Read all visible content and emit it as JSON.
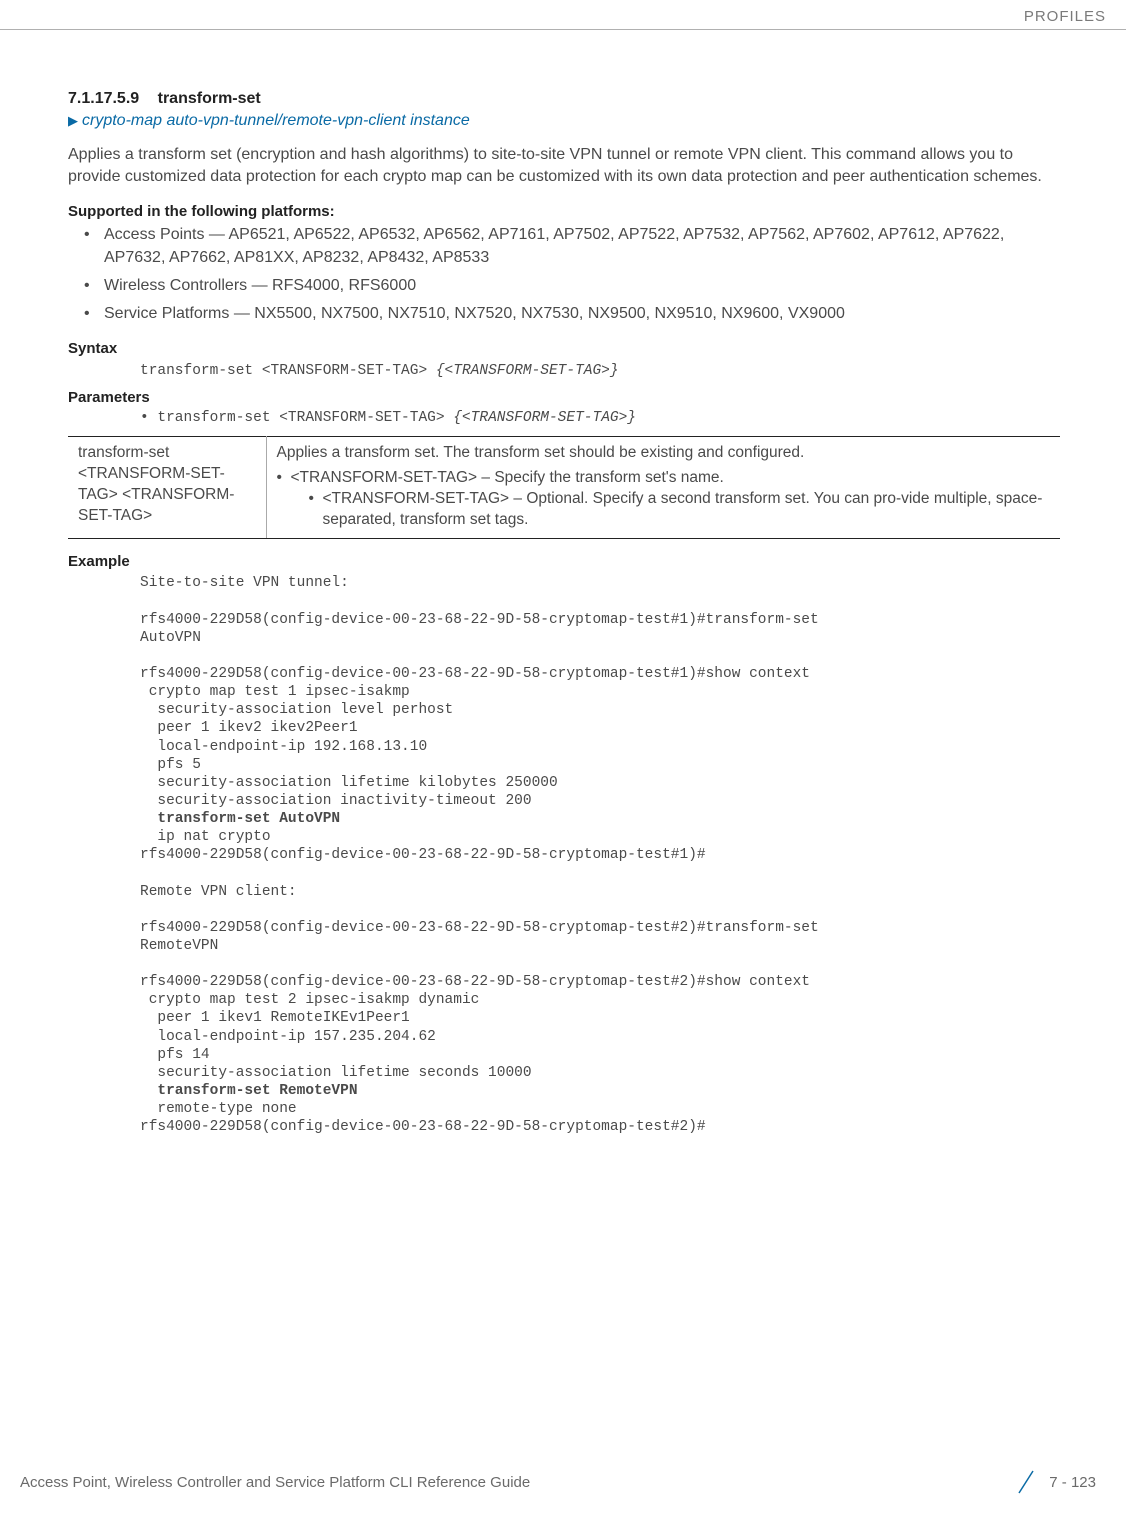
{
  "header": {
    "category": "PROFILES"
  },
  "section": {
    "number": "7.1.17.5.9",
    "title": "transform-set",
    "breadcrumb": "crypto-map auto-vpn-tunnel/remote-vpn-client instance"
  },
  "intro": "Applies a transform set (encryption and hash algorithms) to site-to-site VPN tunnel or remote VPN client. This command allows you to provide customized data protection for each crypto map can be customized with its own data protection and peer authentication schemes.",
  "platforms": {
    "heading": "Supported in the following platforms:",
    "items": [
      "Access Points — AP6521, AP6522, AP6532, AP6562, AP7161, AP7502, AP7522, AP7532, AP7562, AP7602, AP7612, AP7622, AP7632, AP7662, AP81XX, AP8232, AP8432, AP8533",
      "Wireless Controllers — RFS4000, RFS6000",
      "Service Platforms — NX5500, NX7500, NX7510, NX7520, NX7530, NX9500, NX9510, NX9600, VX9000"
    ]
  },
  "syntax": {
    "heading": "Syntax",
    "line_plain": "transform-set <TRANSFORM-SET-TAG> ",
    "line_ital": "{<TRANSFORM-SET-TAG>}"
  },
  "parameters": {
    "heading": "Parameters",
    "bullet_plain": "transform-set <TRANSFORM-SET-TAG> ",
    "bullet_ital": "{<TRANSFORM-SET-TAG>}",
    "table": {
      "left": "transform-set <TRANSFORM-SET-TAG> <TRANSFORM-SET-TAG>",
      "right_top": "Applies a transform set. The transform set should be existing and configured.",
      "right_b1": "<TRANSFORM-SET-TAG> – Specify the transform set's name.",
      "right_b2": "<TRANSFORM-SET-TAG> – Optional. Specify a second transform set. You can pro-vide multiple, space-separated, transform set tags."
    }
  },
  "example": {
    "heading": "Example",
    "l1": "Site-to-site VPN tunnel:",
    "l2": "rfs4000-229D58(config-device-00-23-68-22-9D-58-cryptomap-test#1)#transform-set",
    "l3": "AutoVPN",
    "l4": "rfs4000-229D58(config-device-00-23-68-22-9D-58-cryptomap-test#1)#show context",
    "l5": " crypto map test 1 ipsec-isakmp",
    "l6": "  security-association level perhost",
    "l7": "  peer 1 ikev2 ikev2Peer1",
    "l8": "  local-endpoint-ip 192.168.13.10",
    "l9": "  pfs 5",
    "l10": "  security-association lifetime kilobytes 250000",
    "l11": "  security-association inactivity-timeout 200",
    "l12": "  transform-set AutoVPN",
    "l13": "  ip nat crypto",
    "l14": "rfs4000-229D58(config-device-00-23-68-22-9D-58-cryptomap-test#1)#",
    "l15": "Remote VPN client:",
    "l16": "rfs4000-229D58(config-device-00-23-68-22-9D-58-cryptomap-test#2)#transform-set",
    "l17": "RemoteVPN",
    "l18": "rfs4000-229D58(config-device-00-23-68-22-9D-58-cryptomap-test#2)#show context",
    "l19": " crypto map test 2 ipsec-isakmp dynamic",
    "l20": "  peer 1 ikev1 RemoteIKEv1Peer1",
    "l21": "  local-endpoint-ip 157.235.204.62",
    "l22": "  pfs 14",
    "l23": "  security-association lifetime seconds 10000",
    "l24": "  transform-set RemoteVPN",
    "l25": "  remote-type none",
    "l26": "rfs4000-229D58(config-device-00-23-68-22-9D-58-cryptomap-test#2)#"
  },
  "footer": {
    "guide": "Access Point, Wireless Controller and Service Platform CLI Reference Guide",
    "page": "7 - 123"
  }
}
